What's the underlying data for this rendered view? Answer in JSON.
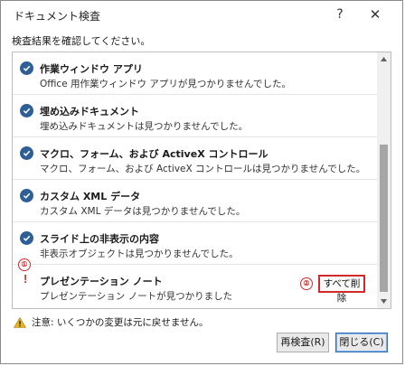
{
  "window": {
    "title": "ドキュメント検査",
    "help": "?",
    "close": "✕"
  },
  "instruction": "検査結果を確認してください。",
  "results": [
    {
      "title": "作業ウィンドウ アプリ",
      "desc": "Office 用作業ウィンドウ アプリが見つかりませんでした。",
      "status": "ok"
    },
    {
      "title": "埋め込みドキュメント",
      "desc": "埋め込みドキュメントは見つかりませんでした。",
      "status": "ok"
    },
    {
      "title": "マクロ、フォーム、および ActiveX コントロール",
      "desc": "マクロ、フォーム、および ActiveX コントロールは見つかりませんでした。",
      "status": "ok"
    },
    {
      "title": "カスタム XML データ",
      "desc": "カスタム XML データは見つかりませんでした。",
      "status": "ok"
    },
    {
      "title": "スライド上の非表示の内容",
      "desc": "非表示オブジェクトは見つかりませんでした。",
      "status": "ok"
    },
    {
      "title": "プレゼンテーション ノート",
      "desc": "プレゼンテーション ノートが見つかりました",
      "status": "found",
      "mark": "!"
    }
  ],
  "remove_all_button": "すべて削除",
  "annotations": [
    "①",
    "②"
  ],
  "footer": {
    "warning": "注意: いくつかの変更は元に戻せません。",
    "reinspect": "再検査(R)",
    "close": "閉じる(C)"
  },
  "colors": {
    "check": "#2e5f96",
    "highlight": "#d22a2a",
    "warning_icon": "#e8b21d"
  }
}
